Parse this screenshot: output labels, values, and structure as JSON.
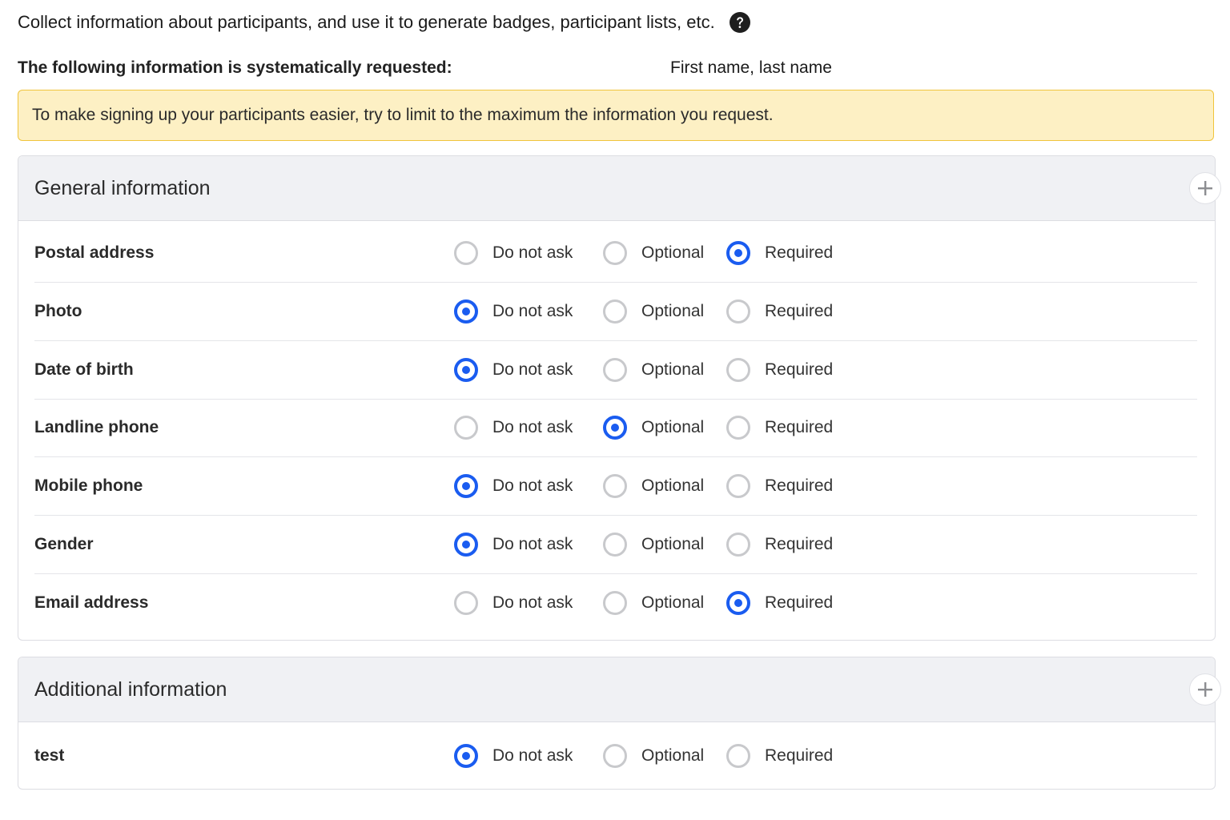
{
  "intro": {
    "text": "Collect information about participants, and use it to generate badges, participant lists, etc.",
    "help_icon": "question-circle-icon"
  },
  "systematic": {
    "label": "The following information is systematically requested:",
    "value": "First name, last name"
  },
  "notice": {
    "text": "To make signing up your participants easier, try to limit to the maximum the information you request.",
    "background": "#fdf0c4",
    "border": "#f0c43c"
  },
  "options": {
    "do_not_ask": "Do not ask",
    "optional": "Optional",
    "required": "Required"
  },
  "accent_color": "#1a5cf0",
  "general": {
    "title": "General information",
    "add_icon": "plus-icon",
    "fields": [
      {
        "label": "Postal address",
        "selected": "required"
      },
      {
        "label": "Photo",
        "selected": "do_not_ask"
      },
      {
        "label": "Date of birth",
        "selected": "do_not_ask"
      },
      {
        "label": "Landline phone",
        "selected": "optional"
      },
      {
        "label": "Mobile phone",
        "selected": "do_not_ask"
      },
      {
        "label": "Gender",
        "selected": "do_not_ask"
      },
      {
        "label": "Email address",
        "selected": "required"
      }
    ]
  },
  "additional": {
    "title": "Additional information",
    "add_icon": "plus-icon",
    "fields": [
      {
        "label": "test",
        "selected": "do_not_ask"
      }
    ]
  }
}
